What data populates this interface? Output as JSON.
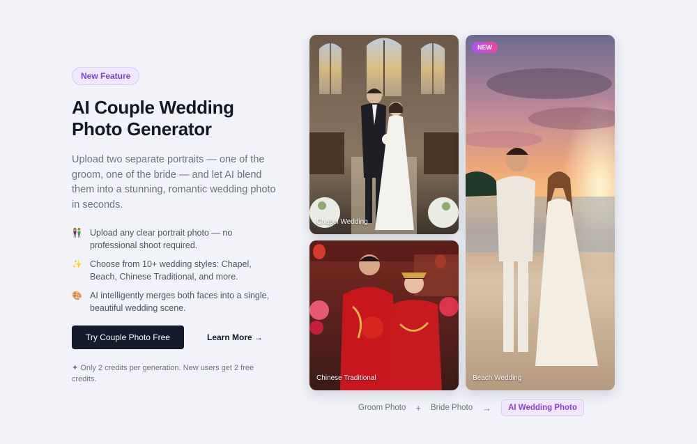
{
  "hero": {
    "badge": "New Feature",
    "title_line1": "AI Couple Wedding",
    "title_line2": "Photo Generator",
    "description": "Upload two separate portraits — one of the groom, one of the bride — and let AI blend them into a stunning, romantic wedding photo in seconds.",
    "features": [
      {
        "icon": "couple-emoji-icon",
        "glyph": "👫",
        "text": "Upload any clear portrait photo — no professional shoot required."
      },
      {
        "icon": "sparkles-emoji-icon",
        "glyph": "✨",
        "text": "Choose from 10+ wedding styles: Chapel, Beach, Chinese Traditional, and more."
      },
      {
        "icon": "palette-emoji-icon",
        "glyph": "🎨",
        "text": "AI intelligently merges both faces into a single, beautiful wedding scene."
      }
    ],
    "cta_primary": "Try Couple Photo Free",
    "cta_secondary": "Learn More →",
    "credits_note": "✦ Only 2 credits per generation. New users get 2 free credits."
  },
  "gallery": {
    "chapel_caption": "Chapel Wedding",
    "chinese_caption": "Chinese Traditional",
    "beach_caption": "Beach Wedding",
    "beach_badge": "NEW"
  },
  "flow": {
    "step1": "Groom Photo",
    "plus": "+",
    "step2": "Bride Photo",
    "arrow": "→",
    "result": "AI Wedding Photo"
  },
  "colors": {
    "background": "#f1f3f8",
    "primary_button": "#141b2d",
    "accent_purple": "#8b3fe0",
    "badge_bg": "#efe7fb"
  }
}
